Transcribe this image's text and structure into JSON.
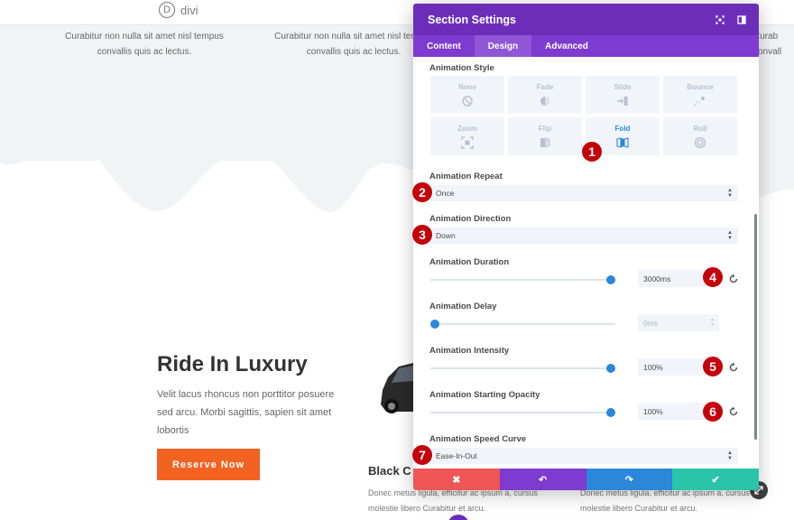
{
  "background_page": {
    "logo_text": "divi",
    "logo_letter": "D",
    "column_texts": [
      "Curabitur non nulla sit amet nisl tempus convallis quis ac lectus.",
      "Curabitur non nulla sit amet nisl tempus convallis quis ac lectus.",
      "Curab convall"
    ],
    "hero_title": "Ride In Luxury",
    "hero_text": "Velit lacus rhoncus non porttitor posuere sed arcu. Morbi sagittis, sapien sit amet lobortis",
    "reserve_button": "Reserve Now",
    "card_title": "Black C",
    "card_text_1": "Donec metus ligula, efficitur ac ipsum a, cursus molestie libero Curabitur et arcu.",
    "card_text_2": "Donec metus ligula, efficitur ac ipsum a, cursus molestie libero Curabitur et arcu."
  },
  "modal": {
    "title": "Section Settings",
    "tabs": [
      {
        "label": "Content",
        "active": false
      },
      {
        "label": "Design",
        "active": true
      },
      {
        "label": "Advanced",
        "active": false
      }
    ],
    "animation_style": {
      "label": "Animation Style",
      "options": [
        {
          "label": "None",
          "icon": "none-icon",
          "active": false
        },
        {
          "label": "Fade",
          "icon": "fade-icon",
          "active": false
        },
        {
          "label": "Slide",
          "icon": "slide-icon",
          "active": false
        },
        {
          "label": "Bounce",
          "icon": "bounce-icon",
          "active": false
        },
        {
          "label": "Zoom",
          "icon": "zoom-icon",
          "active": false
        },
        {
          "label": "Flip",
          "icon": "flip-icon",
          "active": false
        },
        {
          "label": "Fold",
          "icon": "fold-icon",
          "active": true
        },
        {
          "label": "Roll",
          "icon": "roll-icon",
          "active": false
        }
      ]
    },
    "animation_repeat": {
      "label": "Animation Repeat",
      "value": "Once"
    },
    "animation_direction": {
      "label": "Animation Direction",
      "value": "Down"
    },
    "animation_duration": {
      "label": "Animation Duration",
      "value": "3000ms",
      "slider_fraction": 1.0
    },
    "animation_delay": {
      "label": "Animation Delay",
      "value": "0ms",
      "slider_fraction": 0.0
    },
    "animation_intensity": {
      "label": "Animation Intensity",
      "value": "100%",
      "slider_fraction": 1.0
    },
    "animation_starting_opacity": {
      "label": "Animation Starting Opacity",
      "value": "100%",
      "slider_fraction": 1.0
    },
    "animation_speed_curve": {
      "label": "Animation Speed Curve",
      "value": "Ease-In-Out"
    },
    "footer": {
      "cancel_glyph": "✖",
      "undo_glyph": "↶",
      "redo_glyph": "↷",
      "save_glyph": "✔"
    }
  },
  "markers": [
    "1",
    "2",
    "3",
    "4",
    "5",
    "6",
    "7"
  ],
  "colors": {
    "modal_header": "#6c2eb9",
    "tabs_bar": "#7d3bcf",
    "accent_blue": "#2b87da",
    "cancel": "#ef5555",
    "undo": "#7e3bd0",
    "redo": "#2b87da",
    "save": "#29c4a9",
    "marker": "#c4000b",
    "reserve_button": "#f26322"
  }
}
